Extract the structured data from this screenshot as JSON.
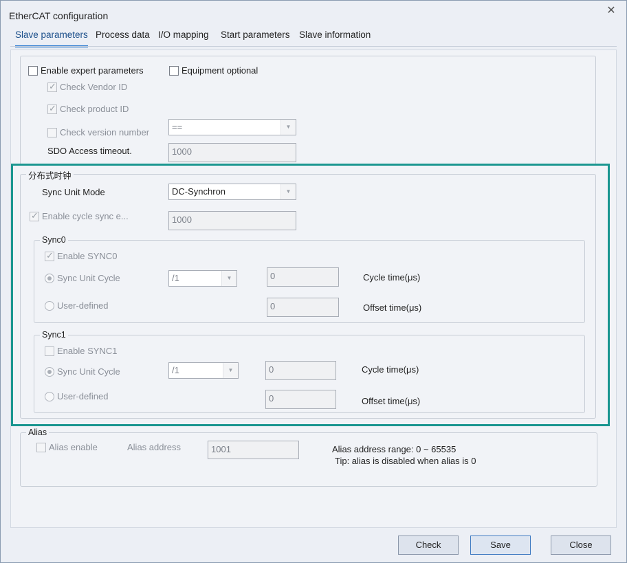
{
  "window": {
    "title": "EtherCAT configuration",
    "close_glyph": "✕"
  },
  "tabs": [
    {
      "label": "Slave parameters",
      "active": true
    },
    {
      "label": "Process data"
    },
    {
      "label": "I/O mapping"
    },
    {
      "label": "Start parameters"
    },
    {
      "label": "Slave information"
    }
  ],
  "general": {
    "enable_expert": "Enable expert parameters",
    "equipment_optional": "Equipment optional",
    "check_vendor_id": "Check Vendor ID",
    "check_product_id": "Check product ID",
    "check_version": "Check version number",
    "version_compare_value": "==",
    "sdo_timeout_label": "SDO Access timeout.",
    "sdo_timeout_value": "1000"
  },
  "dc": {
    "legend": "分布式时钟",
    "sync_unit_mode_label": "Sync Unit Mode",
    "sync_unit_mode_value": "DC-Synchron",
    "enable_cycle_sync": "Enable cycle sync e...",
    "cycle_sync_value": "1000",
    "sync0": {
      "legend": "Sync0",
      "enable": "Enable SYNC0",
      "sync_unit_cycle": "Sync Unit Cycle",
      "divider_value": "/1",
      "user_defined": "User-defined",
      "cycle_value": "0",
      "cycle_label": "Cycle time(μs)",
      "offset_value": "0",
      "offset_label": "Offset time(μs)"
    },
    "sync1": {
      "legend": "Sync1",
      "enable": "Enable SYNC1",
      "sync_unit_cycle": "Sync Unit Cycle",
      "divider_value": "/1",
      "user_defined": "User-defined",
      "cycle_value": "0",
      "cycle_label": "Cycle time(μs)",
      "offset_value": "0",
      "offset_label": "Offset time(μs)"
    }
  },
  "alias": {
    "legend": "Alias",
    "enable": "Alias enable",
    "address_label": "Alias address",
    "address_value": "1001",
    "range_text": "Alias address range: 0 ~ 65535",
    "tip_text": "Tip: alias is disabled when alias is 0"
  },
  "buttons": {
    "check": "Check",
    "save": "Save",
    "close": "Close"
  },
  "colors": {
    "highlight_box": "#1a9690",
    "active_tab_underline": "#2a7ad0"
  }
}
